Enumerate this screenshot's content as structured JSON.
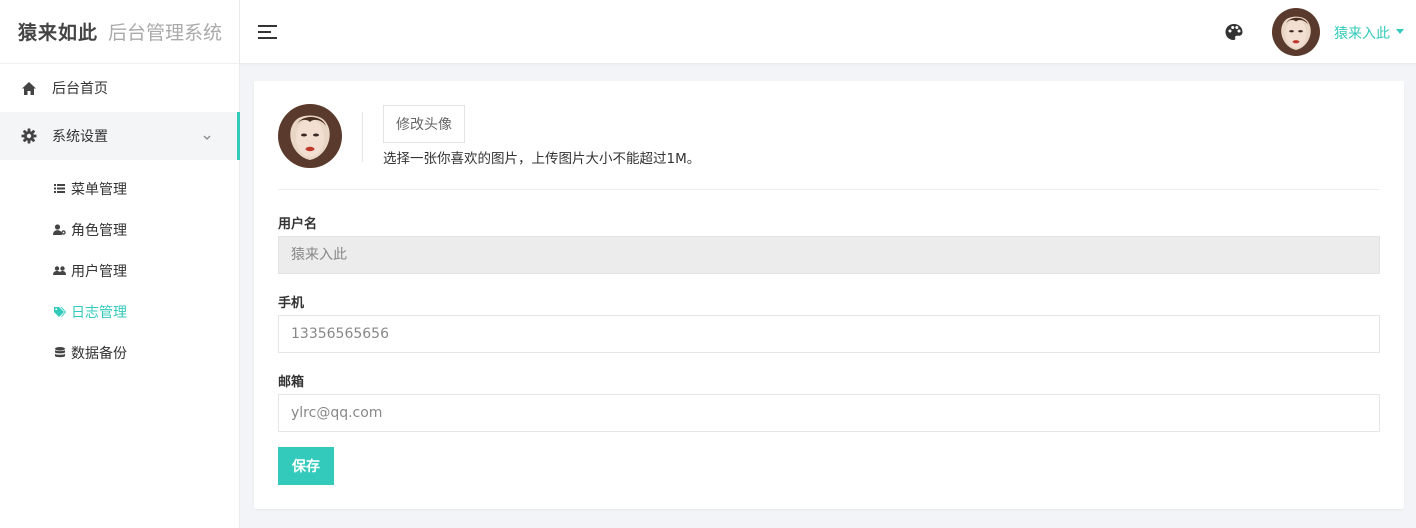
{
  "brand": {
    "logo": "猿来如此",
    "subtitle": "后台管理系统"
  },
  "nav": {
    "home": {
      "label": "后台首页",
      "icon": "home-icon"
    },
    "settings": {
      "label": "系统设置",
      "icon": "gear-icon",
      "expanded": true
    },
    "sub_items": [
      {
        "label": "菜单管理",
        "icon": "list-icon",
        "active": false
      },
      {
        "label": "角色管理",
        "icon": "user-cog-icon",
        "active": false
      },
      {
        "label": "用户管理",
        "icon": "users-icon",
        "active": false
      },
      {
        "label": "日志管理",
        "icon": "tags-icon",
        "active": true
      },
      {
        "label": "数据备份",
        "icon": "database-icon",
        "active": false
      }
    ]
  },
  "topbar": {
    "user_name": "猿来入此"
  },
  "profile": {
    "change_avatar_label": "修改头像",
    "avatar_hint": "选择一张你喜欢的图片，上传图片大小不能超过1M。",
    "username_label": "用户名",
    "username_value": "猿来入此",
    "phone_label": "手机",
    "phone_value": "13356565656",
    "email_label": "邮箱",
    "email_value": "ylrc@qq.com",
    "save_label": "保存"
  },
  "colors": {
    "accent": "#33cabb",
    "background": "#f3f4f8"
  }
}
